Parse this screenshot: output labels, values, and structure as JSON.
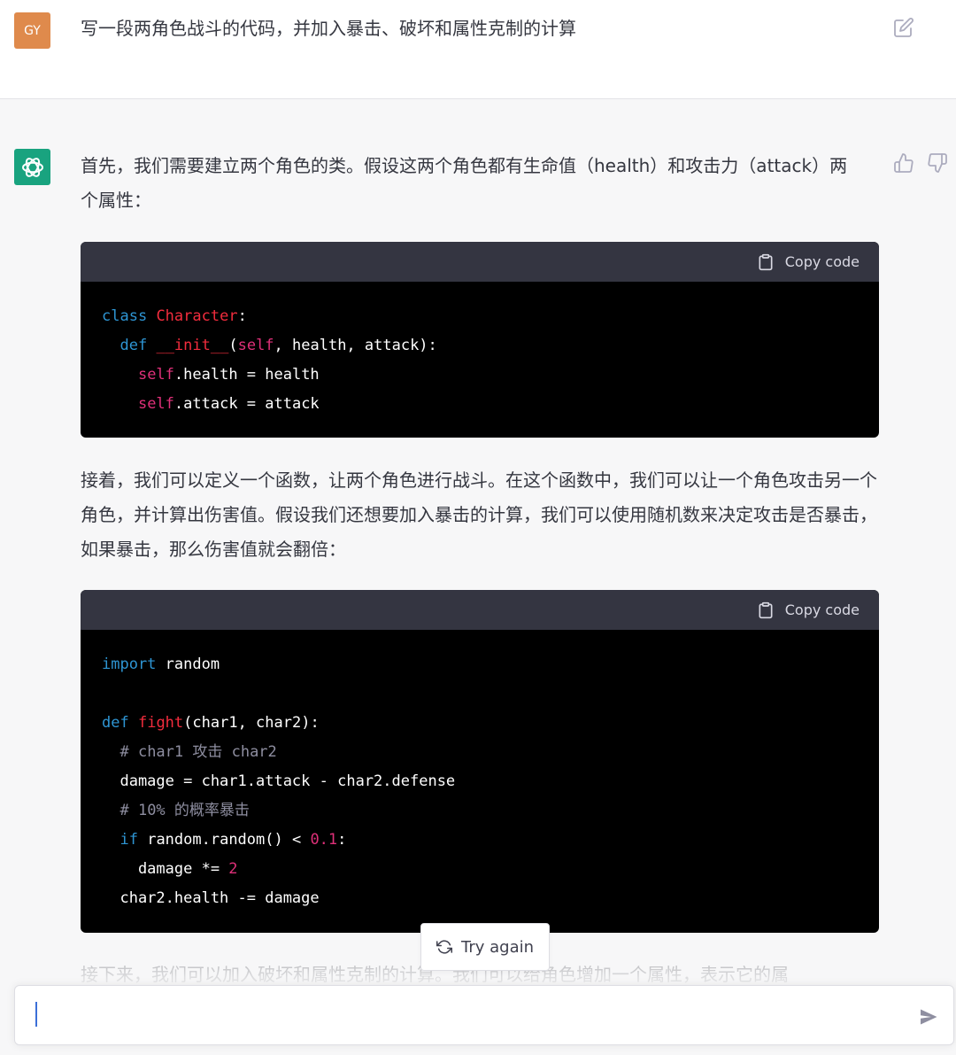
{
  "user_message": {
    "avatar_initials": "GY",
    "text": "写一段两角色战斗的代码，并加入暴击、破坏和属性克制的计算"
  },
  "assistant_message": {
    "intro": "首先，我们需要建立两个角色的类。假设这两个角色都有生命值（health）和攻击力（attack）两个属性：",
    "code_block_1": {
      "copy_label": "Copy code",
      "lines": [
        "class Character:",
        "  def __init__(self, health, attack):",
        "    self.health = health",
        "    self.attack = attack"
      ]
    },
    "paragraph_2": "接着，我们可以定义一个函数，让两个角色进行战斗。在这个函数中，我们可以让一个角色攻击另一个角色，并计算出伤害值。假设我们还想要加入暴击的计算，我们可以使用随机数来决定攻击是否暴击，如果暴击，那么伤害值就会翻倍：",
    "code_block_2": {
      "copy_label": "Copy code",
      "lines": [
        "import random",
        "",
        "def fight(char1, char2):",
        "  # char1 攻击 char2",
        "  damage = char1.attack - char2.defense",
        "  # 10% 的概率暴击",
        "  if random.random() < 0.1:",
        "    damage *= 2",
        "  char2.health -= damage"
      ]
    },
    "paragraph_3_partial": "接下来，我们可以加入破坏和属性克制的计算。我们可以给角色增加一个属性，表示它的属"
  },
  "try_again_label": "Try again",
  "composer": {
    "value": "",
    "placeholder": ""
  },
  "colors": {
    "user_avatar": "#df8a4c",
    "bot_avatar": "#19a37f",
    "code_bg": "#000000",
    "code_header_bg": "#343541",
    "keyword": "#2e95d3",
    "class_name": "#f22c3d",
    "self_and_number": "#df3079",
    "comment": "#8e8ea0"
  },
  "icons": [
    "edit-icon",
    "openai-logo-icon",
    "thumbs-up-icon",
    "thumbs-down-icon",
    "clipboard-icon",
    "refresh-icon",
    "send-icon"
  ]
}
